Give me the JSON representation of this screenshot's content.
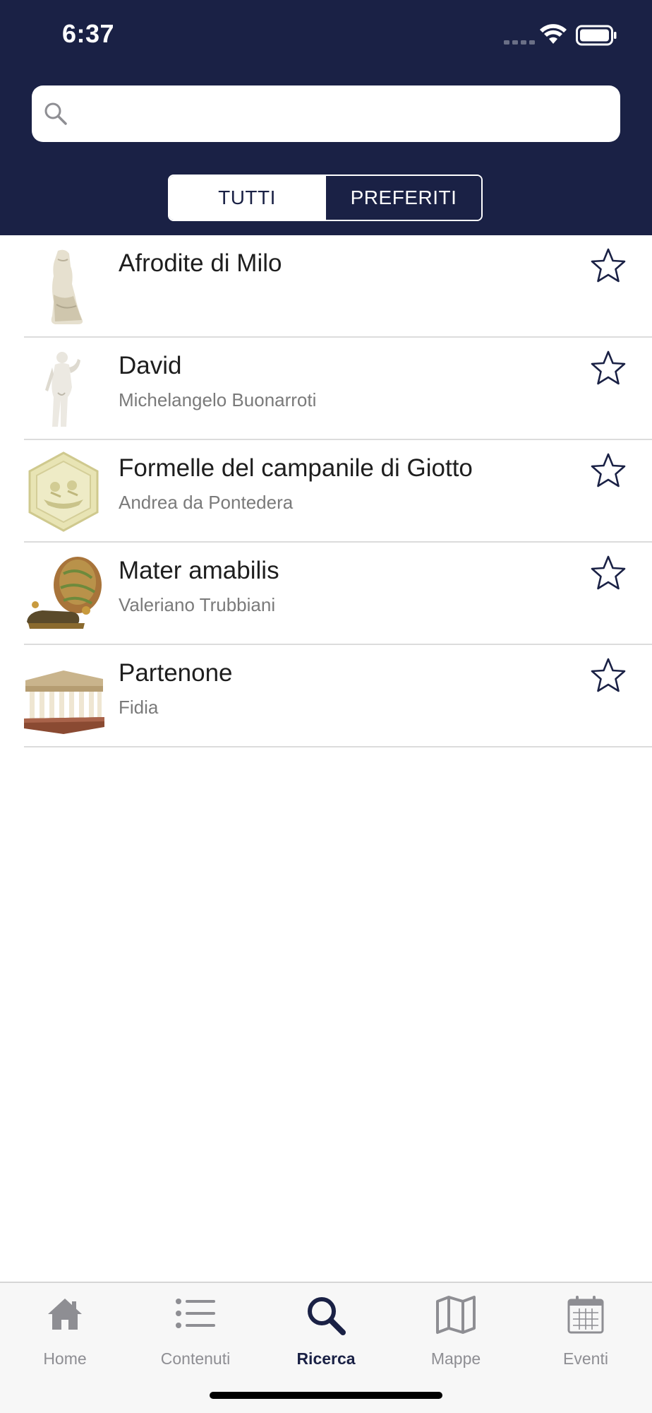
{
  "status_bar": {
    "time": "6:37"
  },
  "search": {
    "placeholder": "",
    "value": ""
  },
  "segmented": {
    "all_label": "TUTTI",
    "favorites_label": "PREFERITI",
    "selected": "TUTTI"
  },
  "items": [
    {
      "title": "Afrodite di Milo",
      "subtitle": "",
      "thumbnail": "statue-torso",
      "favorite": false
    },
    {
      "title": "David",
      "subtitle": "Michelangelo Buonarroti",
      "thumbnail": "statue-david",
      "favorite": false
    },
    {
      "title": "Formelle del campanile di Giotto",
      "subtitle": "Andrea da Pontedera",
      "thumbnail": "hexagon-relief",
      "favorite": false
    },
    {
      "title": "Mater amabilis",
      "subtitle": "Valeriano Trubbiani",
      "thumbnail": "bronze-sculpture",
      "favorite": false
    },
    {
      "title": "Partenone",
      "subtitle": "Fidia",
      "thumbnail": "temple-model",
      "favorite": false
    }
  ],
  "tabbar": {
    "tabs": [
      {
        "label": "Home",
        "icon": "house-icon"
      },
      {
        "label": "Contenuti",
        "icon": "list-icon"
      },
      {
        "label": "Ricerca",
        "icon": "magnifier-icon"
      },
      {
        "label": "Mappe",
        "icon": "map-icon"
      },
      {
        "label": "Eventi",
        "icon": "calendar-icon"
      }
    ],
    "selected": "Ricerca"
  },
  "colors": {
    "header": "#1a2145",
    "accent": "#1a2145",
    "inactive_tab": "#8e8e93",
    "divider": "#dcdcdc"
  }
}
